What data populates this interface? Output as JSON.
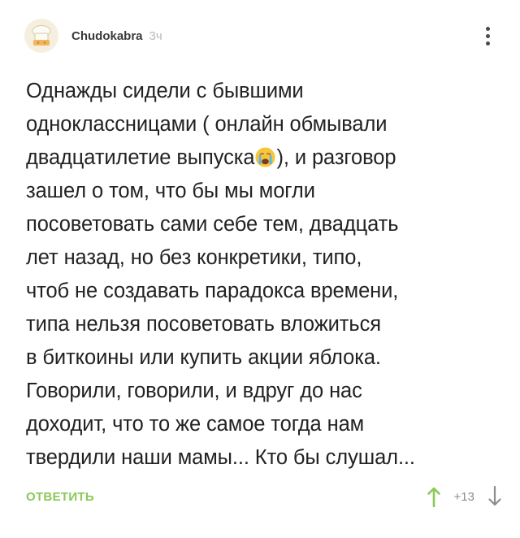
{
  "comment": {
    "author": "Chudokabra",
    "time": "3ч",
    "lines": {
      "l1": "Однажды сидели с бывшими",
      "l2": "одноклассницами ( онлайн обмывали",
      "l3a": "двадцатилетие выпуска",
      "l3b": "), и разговор",
      "l4": "зашел о том, что бы мы могли",
      "l5": "посоветовать сами себе тем, двадцать",
      "l6": "лет назад, но без конкретики, типо,",
      "l7": "чтоб не создавать парадокса времени,",
      "l8": "типа нельзя посоветовать вложиться",
      "l9": "в биткоины или купить акции яблока.",
      "l10": "Говорили, говорили, и вдруг до нас",
      "l11": "доходит, что то же самое тогда нам",
      "l12": "твердили наши мамы... Кто бы слушал..."
    }
  },
  "footer": {
    "reply_label": "ОТВЕТИТЬ",
    "rating": "+13"
  },
  "icons": {
    "avatar": "chef-hat-avatar-icon",
    "emoji": "crying-face-emoji",
    "more": "vertical-dots-icon",
    "upvote": "arrow-up-icon",
    "downvote": "arrow-down-icon"
  },
  "colors": {
    "accent_green": "#8ac858",
    "text": "#222222",
    "muted": "#b9b9b9"
  }
}
